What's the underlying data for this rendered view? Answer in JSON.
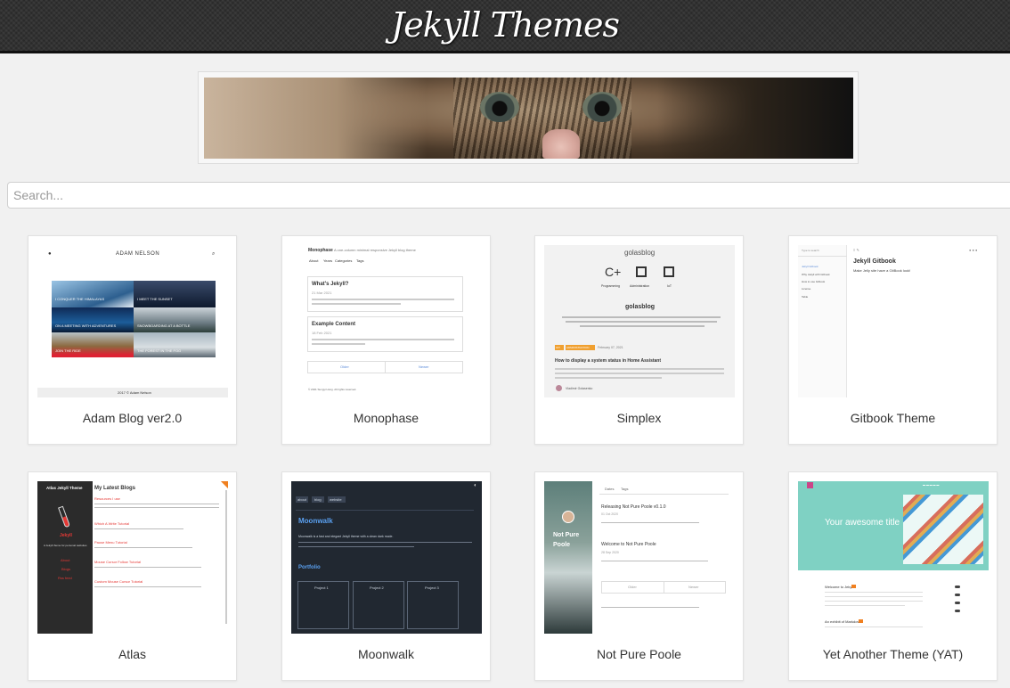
{
  "header": {
    "title": "Jekyll Themes"
  },
  "search": {
    "placeholder": "Search..."
  },
  "themes": [
    {
      "name": "Adam Blog ver2.0",
      "preview": {
        "site_name": "ADAM NELSON",
        "tiles": [
          "I CONQUER THE HIMALAYAS",
          "I MEET THE SUNSET",
          "ON A MEETING WITH ADVENTURES",
          "SNOWBOARDING AT A BOTTLE",
          "JOIN THE RIDE",
          "THE FOREST IN THE FOG"
        ],
        "footer": "2017 © Adam Nelson"
      }
    },
    {
      "name": "Monophase",
      "preview": {
        "title": "Monophase",
        "tagline": "A one-column minimal responsive Jekyll blog theme",
        "nav": [
          "About",
          "Years",
          "Categories",
          "Tags"
        ],
        "post1_title": "What's Jekyll?",
        "post1_date": "21 Mar 2021",
        "post2_title": "Example Content",
        "post2_date": "18 Feb 2021",
        "older": "Older",
        "newer": "Newer",
        "footer": "© 2021 Sungyi Hong. All rights reserved."
      }
    },
    {
      "name": "Simplex",
      "preview": {
        "site": "golasblog",
        "icons": [
          "Programming",
          "Administration",
          "IoT"
        ],
        "heading": "golasblog",
        "badge1": "IOT",
        "badge2": "ADMINISTRATION",
        "date": "February 07, 2021",
        "post_title": "How to display a system status in Home Assistant",
        "author": "Vladimir Golasenko"
      }
    },
    {
      "name": "Gitbook Theme",
      "preview": {
        "search": "Type to search",
        "side_items": [
          "Jekyll Gitbook",
          "Why Jekyll with Gitbook",
          "How to use Gitbook",
          "License",
          "Table"
        ],
        "title": "Jekyll Gitbook",
        "sub": "Make Jelly site have a GitBook look!"
      }
    },
    {
      "name": "Atlas",
      "preview": {
        "sidebar_title": "Atlas Jekyll Theme",
        "brand": "Jekyll",
        "tagline": "A Jekyll theme for personal websites",
        "links": [
          "About",
          "Blogs",
          "Rss feed"
        ],
        "heading": "My Latest Blogs",
        "posts": [
          "Resources I use",
          "Which A Write Tutorial",
          "Pause Menu Tutorial",
          "Mouse Cursor Follow Tutorial",
          "Custom Mouse Cursor Tutorial"
        ]
      }
    },
    {
      "name": "Moonwalk",
      "preview": {
        "nav": [
          "about",
          "blog",
          "website"
        ],
        "title": "Moonwalk",
        "desc": "Moonwalk is a fast and elegant Jekyll theme with a clean dark mode.",
        "section": "Portfolio",
        "projects": [
          "Project 1",
          "Project 2",
          "Project 3"
        ]
      }
    },
    {
      "name": "Not Pure Poole",
      "preview": {
        "side_title": "Not Pure Poole",
        "tabs": [
          "Dates",
          "Tags"
        ],
        "post1": "Releasing Not Pure Poole v0.1.0",
        "post1_date": "01 Oct 2020",
        "post2": "Welcome to Not Pure Poole",
        "post2_date": "28 Sep 2020",
        "older": "Older",
        "newer": "Newer"
      }
    },
    {
      "name": "Yet Another Theme (YAT)",
      "preview": {
        "hero": "Your awesome title",
        "post1": "Welcome to Jekyll!",
        "post2": "An exhibit of Markdown"
      }
    }
  ],
  "colors": {
    "header_bg": "#2e2e2e",
    "page_bg": "#f1f1f1",
    "atlas_red": "#e53935",
    "moonwalk_bg": "#212831",
    "moonwalk_accent": "#5aa0f0",
    "yat_teal": "#7fd1c3",
    "simplex_orange": "#f0a030"
  }
}
